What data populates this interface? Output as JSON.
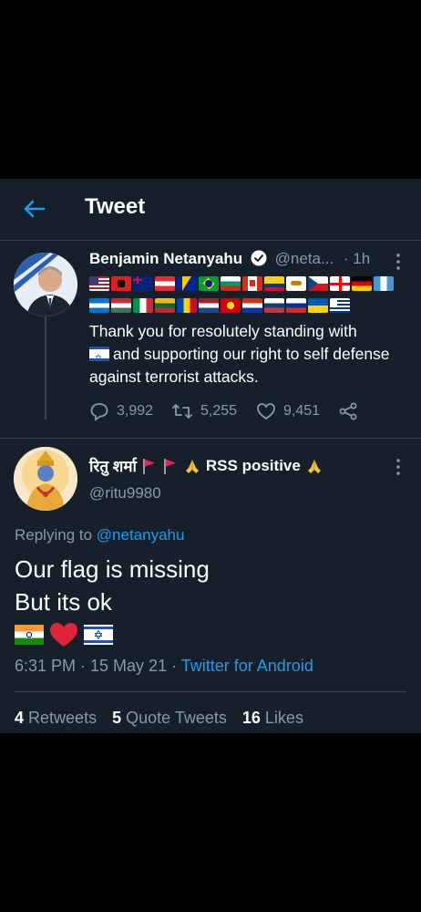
{
  "header": {
    "title": "Tweet"
  },
  "parent_tweet": {
    "name": "Benjamin Netanyahu",
    "handle": "@neta...",
    "time": "· 1h",
    "text": "Thank you for resolutely standing with",
    "text_line2": "and supporting our right to self defense against terrorist attacks.",
    "replies": "3,992",
    "retweets": "5,255",
    "likes": "9,451"
  },
  "tweet": {
    "name": "रितु शर्मा",
    "name_suffix": "RSS positive",
    "handle": "@ritu9980",
    "replying_prefix": "Replying to",
    "replying_to": "@netanyahu",
    "text_line1": "Our flag is missing",
    "text_line2": "But its ok",
    "time": "6:31 PM · 15 May 21 ·",
    "client": "Twitter for Android"
  },
  "stats": {
    "retweets_count": "4",
    "retweets_label": "Retweets",
    "quotes_count": "5",
    "quotes_label": "Quote Tweets",
    "likes_count": "16",
    "likes_label": "Likes"
  },
  "colors": {
    "background": "#15202b",
    "accent": "#1d9bf0",
    "muted": "#8899a6",
    "divider": "#38444d"
  },
  "icons": [
    "back-arrow-icon",
    "verified-icon",
    "more-icon",
    "reply-icon",
    "retweet-icon",
    "like-icon",
    "share-icon",
    "flag-icon",
    "heart-icon",
    "folded-hands-icon"
  ]
}
